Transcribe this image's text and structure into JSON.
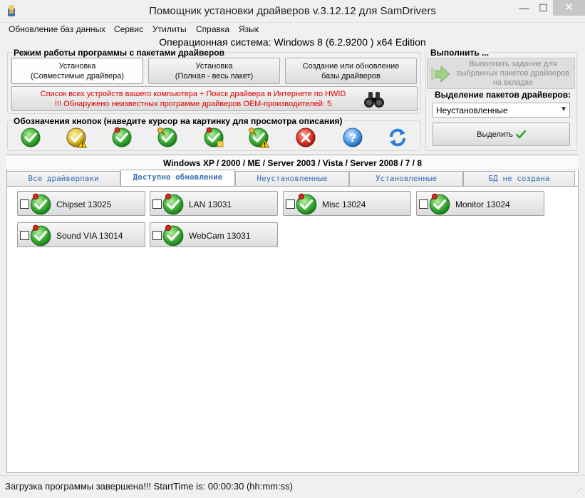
{
  "window": {
    "title": "Помощник установки драйверов v.3.12.12 для SamDrivers",
    "minimize": "—",
    "maximize": "☐",
    "close": "✕"
  },
  "menu": [
    "Обновление баз данных",
    "Сервис",
    "Утилиты",
    "Справка",
    "Язык"
  ],
  "os_info": "Операционная система: Windows 8  (6.2.9200 ) x64 Edition",
  "mode_group": {
    "title": "Режим работы программы с пакетами драйверов",
    "buttons": [
      {
        "line1": "Установка",
        "line2": "(Совместимые драйвера)"
      },
      {
        "line1": "Установка",
        "line2": "(Полная - весь пакет)"
      },
      {
        "line1": "Создание или обновление",
        "line2": "базы драйверов"
      }
    ],
    "hwid_line1": "Список всех устройств вашего компьютера + Поиск драйвера в Интернете по HWID",
    "hwid_line2": "!!! Обнаружено неизвестных программе драйверов OEM-производителей: 5"
  },
  "legend": {
    "title": "Обозначения кнопок (наведите курсор на картинку для просмотра описания)"
  },
  "execute": {
    "title": "Выполнить ...",
    "button_line1": "Выполнить задание для",
    "button_line2": "выбранных пакетов драйверов",
    "button_line3": "на вкладке"
  },
  "selection": {
    "title": "Выделение пакетов драйверов:",
    "selected": "Неустановленные",
    "button": "Выделить"
  },
  "os_tab_title": "Windows XP / 2000 / ME / Server 2003 / Vista / Server 2008 / 7 / 8",
  "tabs": [
    "Все драйверпаки",
    "Доступно обновление",
    "Неустановленные",
    "Установленные",
    "БД не создана"
  ],
  "drivers": [
    "Chipset 13025",
    "LAN 13031",
    "Misc 13024",
    "Monitor 13024",
    "Sound VIA 13014",
    "WebCam 13031"
  ],
  "status": "Загрузка программы завершена!!! StartTime is: 00:00:30 (hh:mm:ss)",
  "colors": {
    "accent": "#3a6fb4",
    "warning_red": "#e00000",
    "ok_green": "#2ea82e"
  }
}
